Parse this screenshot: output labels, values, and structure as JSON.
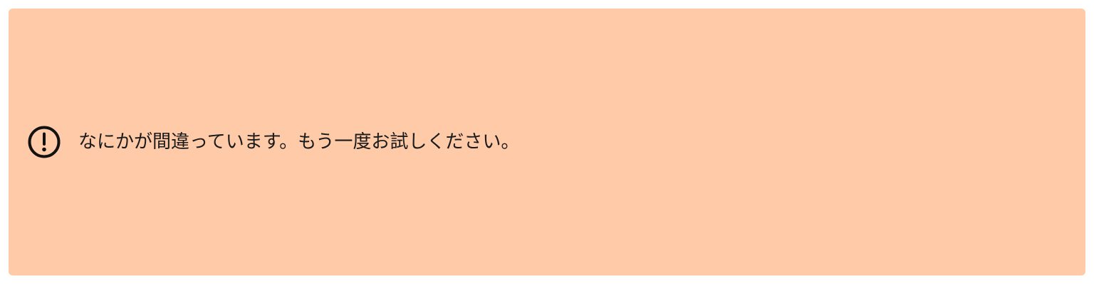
{
  "alert": {
    "icon": "exclamation-circle-icon",
    "message": "なにかが間違っています。もう一度お試しください。",
    "background_color": "#ffcaa8",
    "text_color": "#1a1a1a"
  }
}
